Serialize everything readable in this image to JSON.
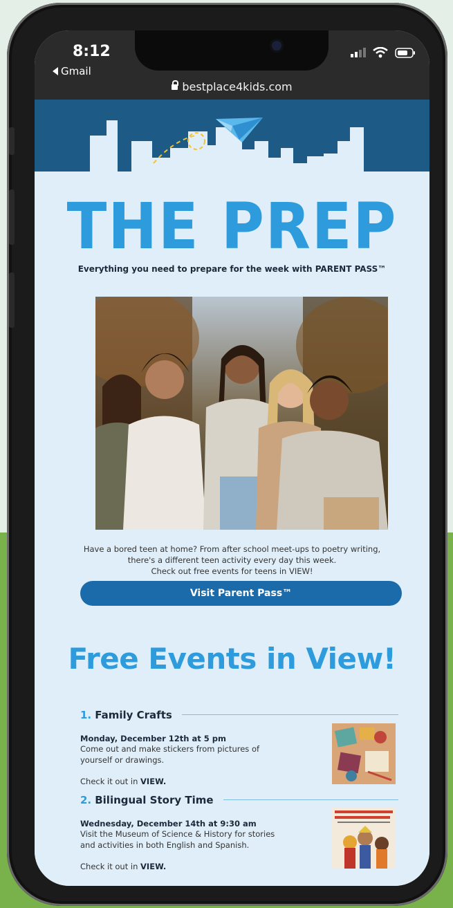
{
  "status_bar": {
    "time": "8:12",
    "back_app": "Gmail",
    "url": "bestplace4kids.com"
  },
  "email": {
    "title": "THE PREP",
    "tagline": "Everything you need to prepare for the week with PARENT PASS™",
    "intro_lines": [
      "Have a bored teen at home? From after school meet-ups to poetry writing,",
      "there's a different teen activity every day this week.",
      "Check out free events for teens in VIEW!"
    ],
    "cta_label": "Visit Parent Pass™",
    "section_title": "Free Events in View!",
    "events": [
      {
        "num": "1.",
        "name": "Family Crafts",
        "date": "Monday, December 12th at 5 pm",
        "desc": "Come out and make stickers from pictures of yourself or drawings.",
        "link_prefix": "Check it out in",
        "link_strong": "VIEW."
      },
      {
        "num": "2.",
        "name": "Bilingual Story Time",
        "date": "Wednesday, December 14th at 9:30 am",
        "desc": "Visit the Museum of Science & History for stories and activities in both English and Spanish.",
        "link_prefix": "Check it out in",
        "link_strong": "VIEW."
      }
    ]
  },
  "colors": {
    "brand_blue": "#2e9bdc",
    "navy": "#1d5b86",
    "button": "#1b6aaa",
    "background_green": "#79b24a"
  },
  "icons": [
    "chevron-left-icon",
    "lock-icon",
    "signal-icon",
    "wifi-icon",
    "battery-icon",
    "paper-plane-icon"
  ]
}
